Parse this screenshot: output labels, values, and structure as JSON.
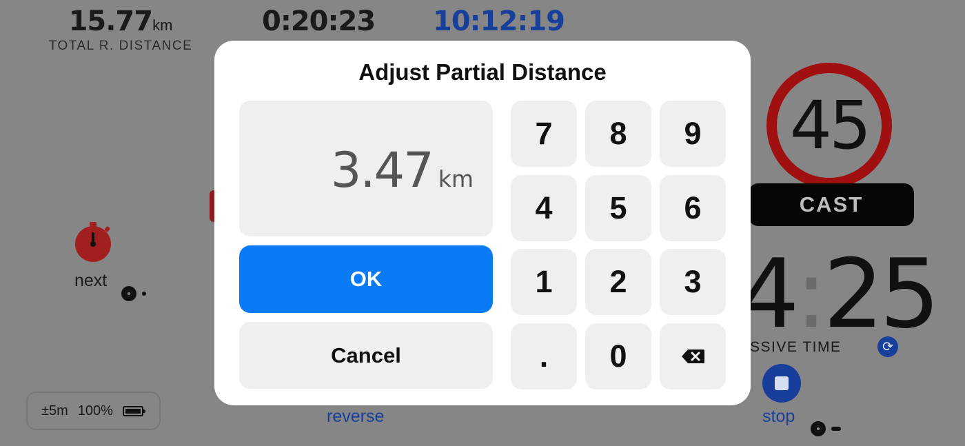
{
  "header": {
    "total_distance_value": "15.77",
    "total_distance_unit": "km",
    "total_distance_label": "TOTAL R. DISTANCE",
    "elapsed_time": "0:20:23",
    "clock_time": "10:12:19"
  },
  "left_panel": {
    "next_label": "next",
    "status_accuracy": "±5m",
    "status_battery": "100%"
  },
  "bottom": {
    "reverse_label": "reverse",
    "stop_label": "stop"
  },
  "right_panel": {
    "speed_limit": "45",
    "cast_label": "CAST",
    "time_minutes": "4",
    "time_colon": ":",
    "time_seconds": "25",
    "time_label": "SSIVE TIME"
  },
  "dialog": {
    "title": "Adjust Partial Distance",
    "value": "3.47",
    "unit": "km",
    "ok_label": "OK",
    "cancel_label": "Cancel",
    "keys": [
      "7",
      "8",
      "9",
      "4",
      "5",
      "6",
      "1",
      "2",
      "3",
      ".",
      "0"
    ]
  },
  "colors": {
    "ok_button": "#0a7bf5",
    "accent_blue": "#18409a",
    "speed_ring": "#a01010",
    "overlay_gray": "#868686"
  },
  "icons": [
    "stopwatch-icon",
    "target-icon",
    "battery-icon",
    "refresh-icon",
    "stop-icon",
    "backspace-icon"
  ]
}
